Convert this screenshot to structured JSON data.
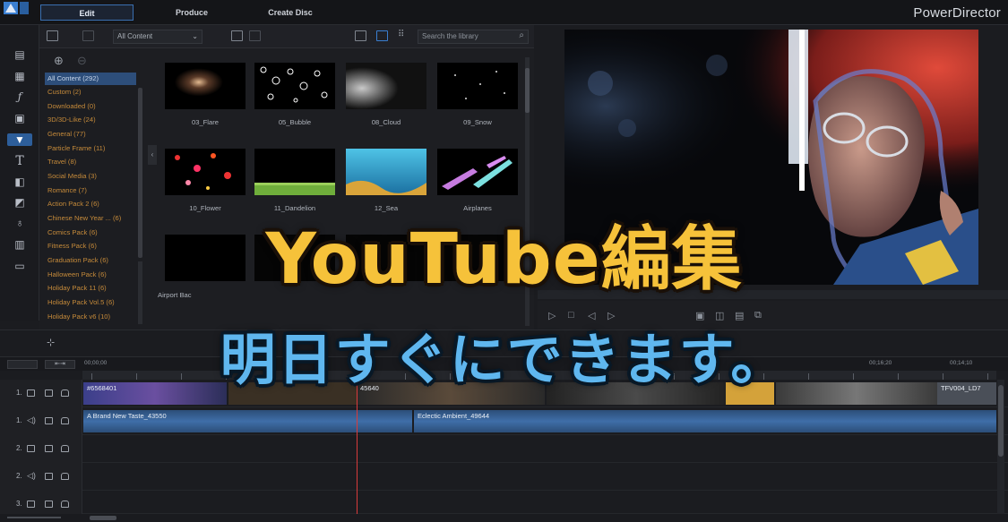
{
  "app": {
    "brand": "PowerDirector"
  },
  "tabs": [
    {
      "label": "Edit"
    },
    {
      "label": "Produce"
    },
    {
      "label": "Create Disc"
    }
  ],
  "library": {
    "filter": "All Content",
    "search_placeholder": "Search the library",
    "categories": [
      {
        "label": "All Content  (292)"
      },
      {
        "label": "Custom  (2)"
      },
      {
        "label": "Downloaded  (0)"
      },
      {
        "label": "3D/3D-Like  (24)"
      },
      {
        "label": "General  (77)"
      },
      {
        "label": "Particle Frame  (11)"
      },
      {
        "label": "Travel  (8)"
      },
      {
        "label": "Social Media  (3)"
      },
      {
        "label": "Romance  (7)"
      },
      {
        "label": "Action Pack 2  (6)"
      },
      {
        "label": "Chinese New Year ...  (6)"
      },
      {
        "label": "Comics Pack  (6)"
      },
      {
        "label": "Fitness Pack  (6)"
      },
      {
        "label": "Graduation Pack  (6)"
      },
      {
        "label": "Halloween Pack  (6)"
      },
      {
        "label": "Holiday Pack 11  (6)"
      },
      {
        "label": "Holiday Pack Vol.5  (6)"
      },
      {
        "label": "Holiday Pack v6  (10)"
      }
    ],
    "items": [
      {
        "label": "03_Flare"
      },
      {
        "label": "05_Bubble"
      },
      {
        "label": "08_Cloud"
      },
      {
        "label": "09_Snow"
      },
      {
        "label": "10_Flower"
      },
      {
        "label": "11_Dandelion"
      },
      {
        "label": "12_Sea"
      },
      {
        "label": "Airplanes"
      },
      {
        "label": "Airport Bac"
      }
    ]
  },
  "timeline": {
    "ruler": [
      "00;00;00",
      "00;16;20",
      "00;14;10"
    ],
    "tracks": [
      {
        "num": "1."
      },
      {
        "num": "1."
      },
      {
        "num": "2."
      },
      {
        "num": "2."
      },
      {
        "num": "3."
      }
    ],
    "clips": [
      {
        "label": "#6568401"
      },
      {
        "label": "45640"
      },
      {
        "label": "TFV004_LD7"
      },
      {
        "label": "A Brand New Taste_43550"
      },
      {
        "label": "Eclectic Ambient_49644"
      }
    ]
  },
  "overlay": {
    "headline": "YouTube編集",
    "subline": "明日すぐにできます。"
  },
  "colors": {
    "accent": "#2d5e9a",
    "headline": "#f6c23a",
    "subline": "#5fb7ef",
    "category_text": "#c58a3a",
    "playhead": "#d93b3b"
  }
}
